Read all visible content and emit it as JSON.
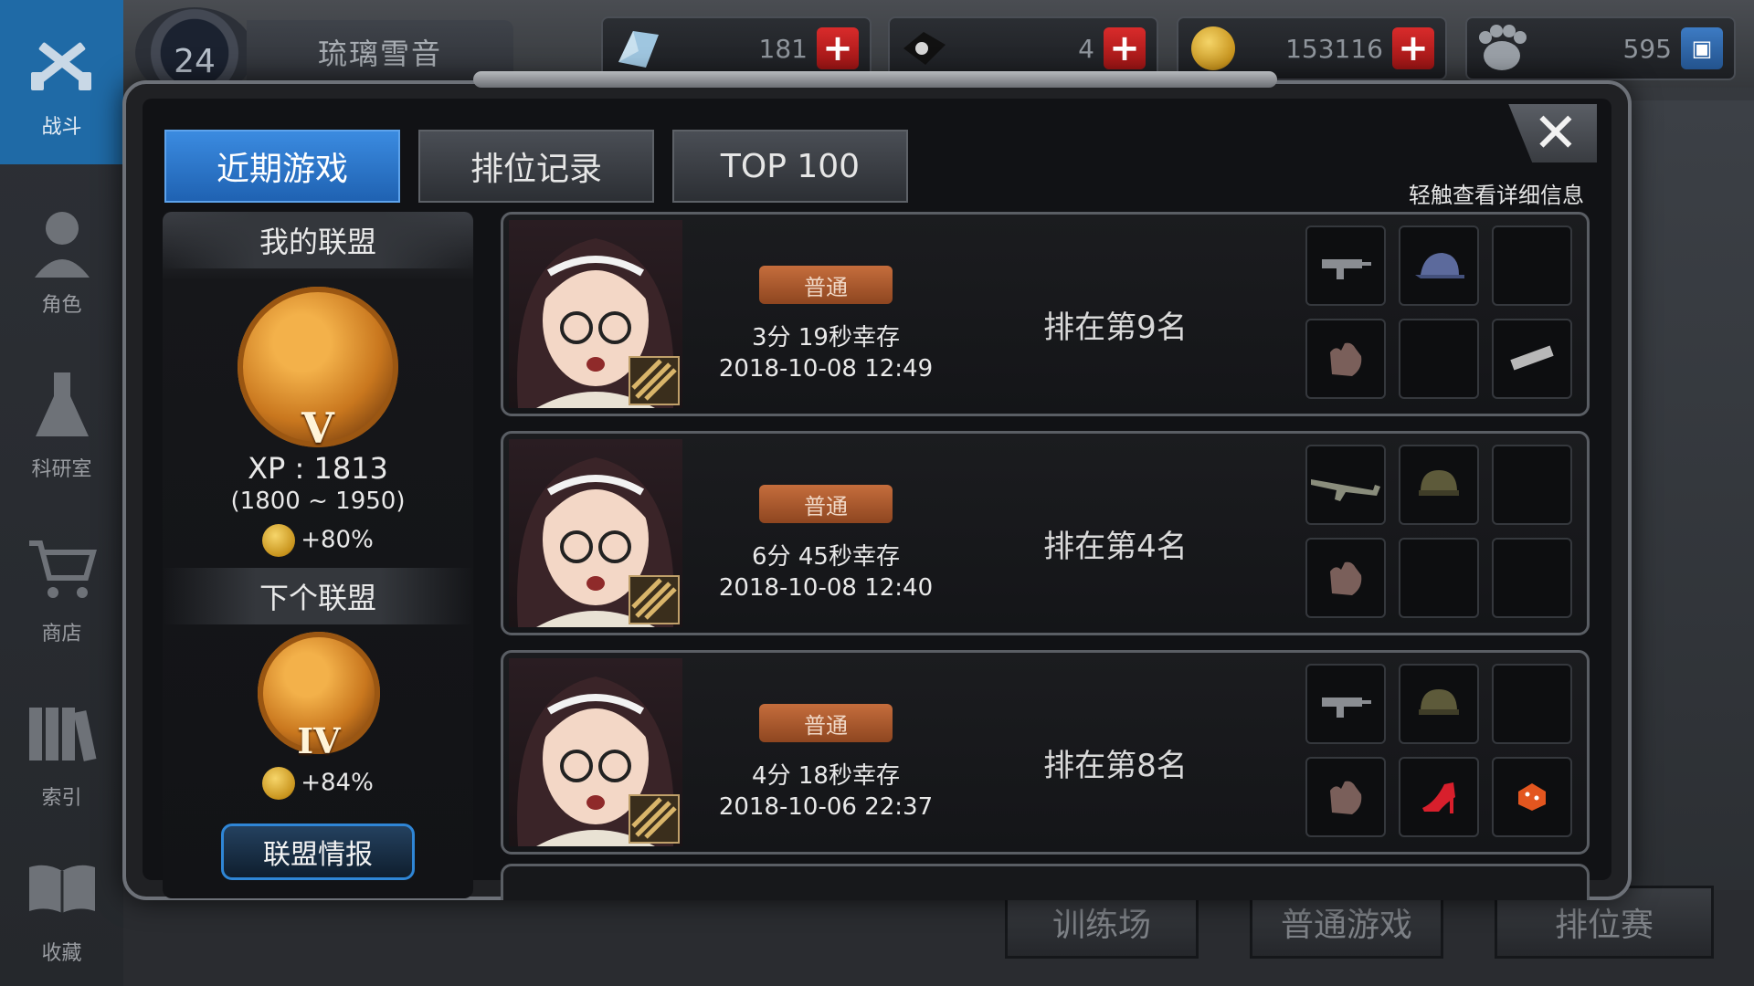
{
  "sidebar": {
    "items": [
      {
        "label": "战斗",
        "icon": "crossed-guns-icon",
        "active": true
      },
      {
        "label": "角色",
        "icon": "character-icon"
      },
      {
        "label": "科研室",
        "icon": "flask-icon"
      },
      {
        "label": "商店",
        "icon": "cart-icon"
      },
      {
        "label": "索引",
        "icon": "books-icon"
      },
      {
        "label": "收藏",
        "icon": "open-book-icon"
      }
    ]
  },
  "player": {
    "level": "24",
    "name": "琉璃雪音"
  },
  "currencies": [
    {
      "name": "crystal",
      "icon": "crystal-icon",
      "value": "181"
    },
    {
      "name": "ticket",
      "icon": "ticket-icon",
      "value": "4"
    },
    {
      "name": "gold",
      "icon": "gold-coin-icon",
      "value": "153116"
    },
    {
      "name": "bp",
      "icon": "bp-paw-icon",
      "value": "595"
    }
  ],
  "background": {
    "modes": [
      "训练场",
      "普通游戏",
      "排位赛"
    ]
  },
  "modal": {
    "tabs": [
      "近期游戏",
      "排位记录",
      "TOP 100"
    ],
    "active_tab": 0,
    "hint": "轻触查看详细信息",
    "close_label": "✕"
  },
  "league": {
    "my_title": "我的联盟",
    "my_tier": "V",
    "xp_text": "XP : 1813",
    "xp_range": "(1800 ~ 1950)",
    "my_bonus": "+80%",
    "next_title": "下个联盟",
    "next_tier": "IV",
    "next_bonus": "+84%",
    "button": "联盟情报"
  },
  "games": [
    {
      "mode": "普通",
      "survive": "3分 19秒幸存",
      "time": "2018-10-08 12:49",
      "rank": "排在第9名",
      "items": [
        "smg-icon",
        "cap-icon",
        "empty",
        "glove-icon",
        "empty",
        "magazine-icon"
      ]
    },
    {
      "mode": "普通",
      "survive": "6分 45秒幸存",
      "time": "2018-10-08 12:40",
      "rank": "排在第4名",
      "items": [
        "rifle-icon",
        "helmet-icon",
        "empty",
        "glove-icon",
        "empty",
        "empty"
      ]
    },
    {
      "mode": "普通",
      "survive": "4分 18秒幸存",
      "time": "2018-10-06 22:37",
      "rank": "排在第8名",
      "items": [
        "smg-icon",
        "helmet-icon",
        "empty",
        "glove-icon",
        "heel-shoe-icon",
        "dice-icon"
      ]
    }
  ]
}
